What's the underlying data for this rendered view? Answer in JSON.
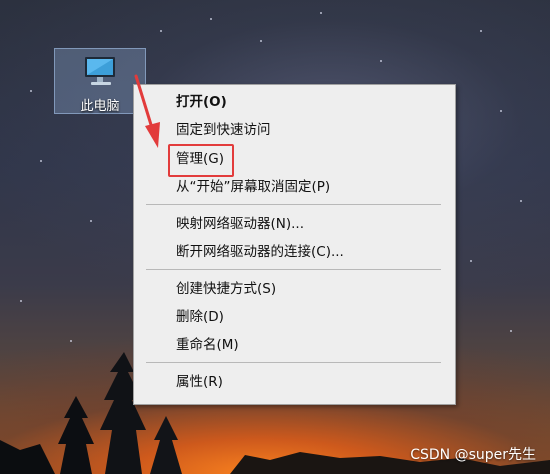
{
  "desktop": {
    "icon_label": "此电脑",
    "icon_name": "computer-icon"
  },
  "menu": {
    "items": [
      {
        "label": "打开(O)",
        "bold": true
      },
      {
        "label": "固定到快速访问"
      },
      {
        "label": "管理(G)",
        "highlighted": true
      },
      {
        "label": "从“开始”屏幕取消固定(P)"
      },
      {
        "label": "映射网络驱动器(N)..."
      },
      {
        "label": "断开网络驱动器的连接(C)..."
      },
      {
        "label": "创建快捷方式(S)"
      },
      {
        "label": "删除(D)"
      },
      {
        "label": "重命名(M)"
      },
      {
        "label": "属性(R)"
      }
    ]
  },
  "annotation": {
    "color": "#e23b3b"
  },
  "watermark": "CSDN @super先生"
}
